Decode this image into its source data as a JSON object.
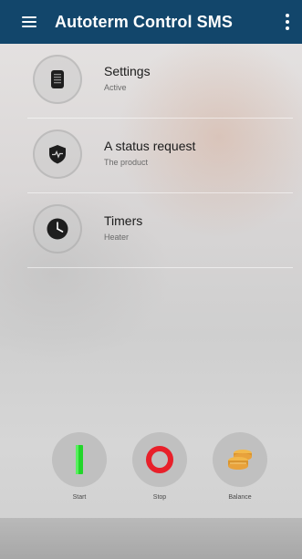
{
  "app": {
    "title": "Autoterm Control SMS"
  },
  "list": [
    {
      "title": "Settings",
      "subtitle": "Active",
      "icon": "smartwatch-icon"
    },
    {
      "title": "A status request",
      "subtitle": "The product",
      "icon": "shield-pulse-icon"
    },
    {
      "title": "Timers",
      "subtitle": "Heater",
      "icon": "clock-icon"
    }
  ],
  "actions": [
    {
      "label": "Start",
      "icon": "start-bar-icon",
      "color": "#22d62a"
    },
    {
      "label": "Stop",
      "icon": "stop-ring-icon",
      "color": "#e8202a"
    },
    {
      "label": "Balance",
      "icon": "coins-stack-icon",
      "color": "#e8a23c"
    }
  ],
  "colors": {
    "appbar": "#12466b"
  }
}
